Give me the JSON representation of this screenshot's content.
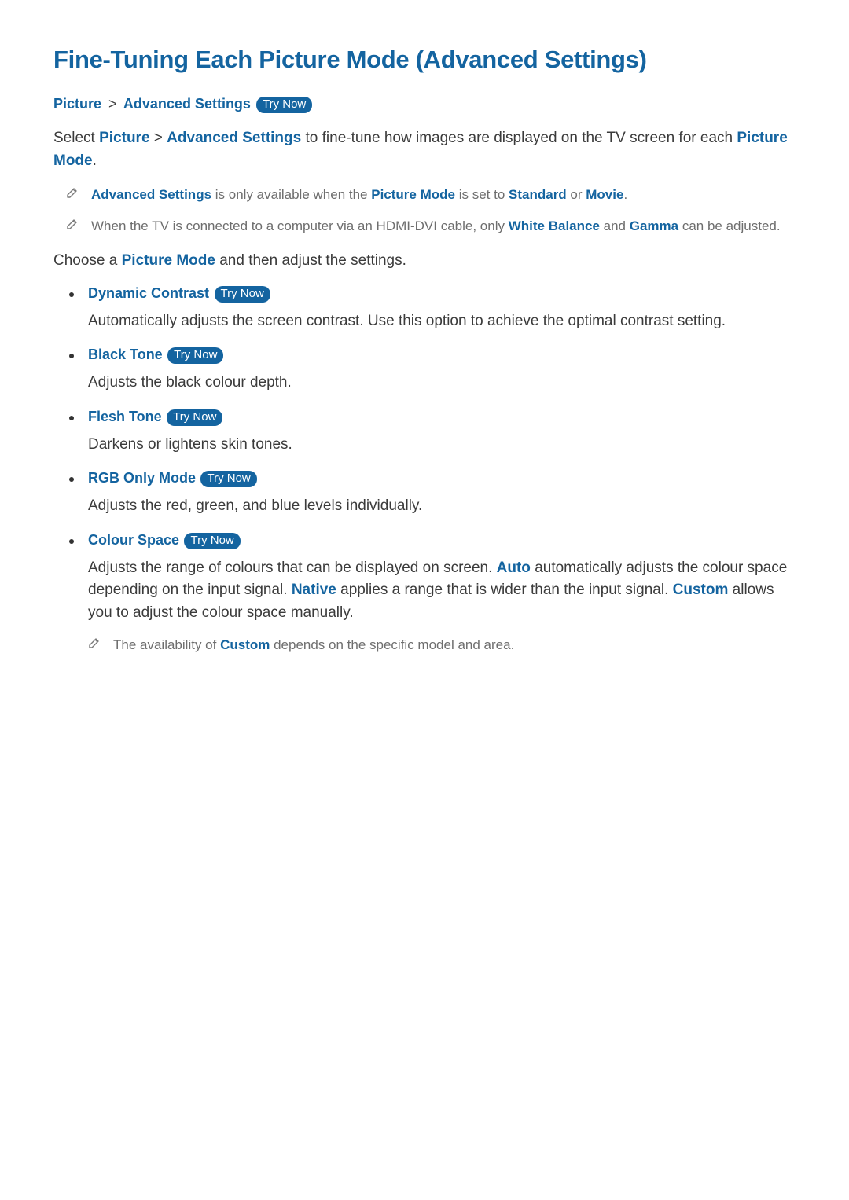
{
  "title": "Fine-Tuning Each Picture Mode (Advanced Settings)",
  "breadcrumb": {
    "a": "Picture",
    "sep": ">",
    "b": "Advanced Settings"
  },
  "try_now": "Try Now",
  "intro": {
    "pre": "Select ",
    "link_a": "Picture",
    "sep": " > ",
    "link_b": "Advanced Settings",
    "mid": " to fine-tune how images are displayed on the TV screen for each ",
    "picture_mode": "Picture Mode",
    "period": "."
  },
  "notes": [
    {
      "parts": [
        {
          "t": "Advanced Settings",
          "accent": true
        },
        {
          "t": " is only available when the "
        },
        {
          "t": "Picture Mode",
          "accent": true
        },
        {
          "t": " is set to "
        },
        {
          "t": "Standard",
          "accent": true
        },
        {
          "t": " or "
        },
        {
          "t": "Movie",
          "accent": true
        },
        {
          "t": "."
        }
      ]
    },
    {
      "parts": [
        {
          "t": "When the TV is connected to a computer via an HDMI-DVI cable, only "
        },
        {
          "t": "White Balance",
          "accent": true
        },
        {
          "t": " and "
        },
        {
          "t": "Gamma",
          "accent": true
        },
        {
          "t": " can be adjusted."
        }
      ]
    }
  ],
  "choose_line": {
    "pre": "Choose a ",
    "picture_mode": "Picture Mode",
    "post": " and then adjust the settings."
  },
  "settings": [
    {
      "name": "Dynamic Contrast",
      "desc": [
        {
          "t": "Automatically adjusts the screen contrast. Use this option to achieve the optimal contrast setting."
        }
      ]
    },
    {
      "name": "Black Tone",
      "desc": [
        {
          "t": "Adjusts the black colour depth."
        }
      ]
    },
    {
      "name": "Flesh Tone",
      "desc": [
        {
          "t": "Darkens or lightens skin tones."
        }
      ]
    },
    {
      "name": "RGB Only Mode",
      "desc": [
        {
          "t": "Adjusts the red, green, and blue levels individually."
        }
      ]
    },
    {
      "name": "Colour Space",
      "desc": [
        {
          "t": "Adjusts the range of colours that can be displayed on screen. "
        },
        {
          "t": "Auto",
          "accent": true
        },
        {
          "t": " automatically adjusts the colour space depending on the input signal. "
        },
        {
          "t": "Native",
          "accent": true
        },
        {
          "t": " applies a range that is wider than the input signal. "
        },
        {
          "t": "Custom",
          "accent": true
        },
        {
          "t": " allows you to adjust the colour space manually."
        }
      ],
      "subnote": [
        {
          "t": "The availability of "
        },
        {
          "t": "Custom",
          "accent": true
        },
        {
          "t": " depends on the specific model and area."
        }
      ]
    }
  ]
}
